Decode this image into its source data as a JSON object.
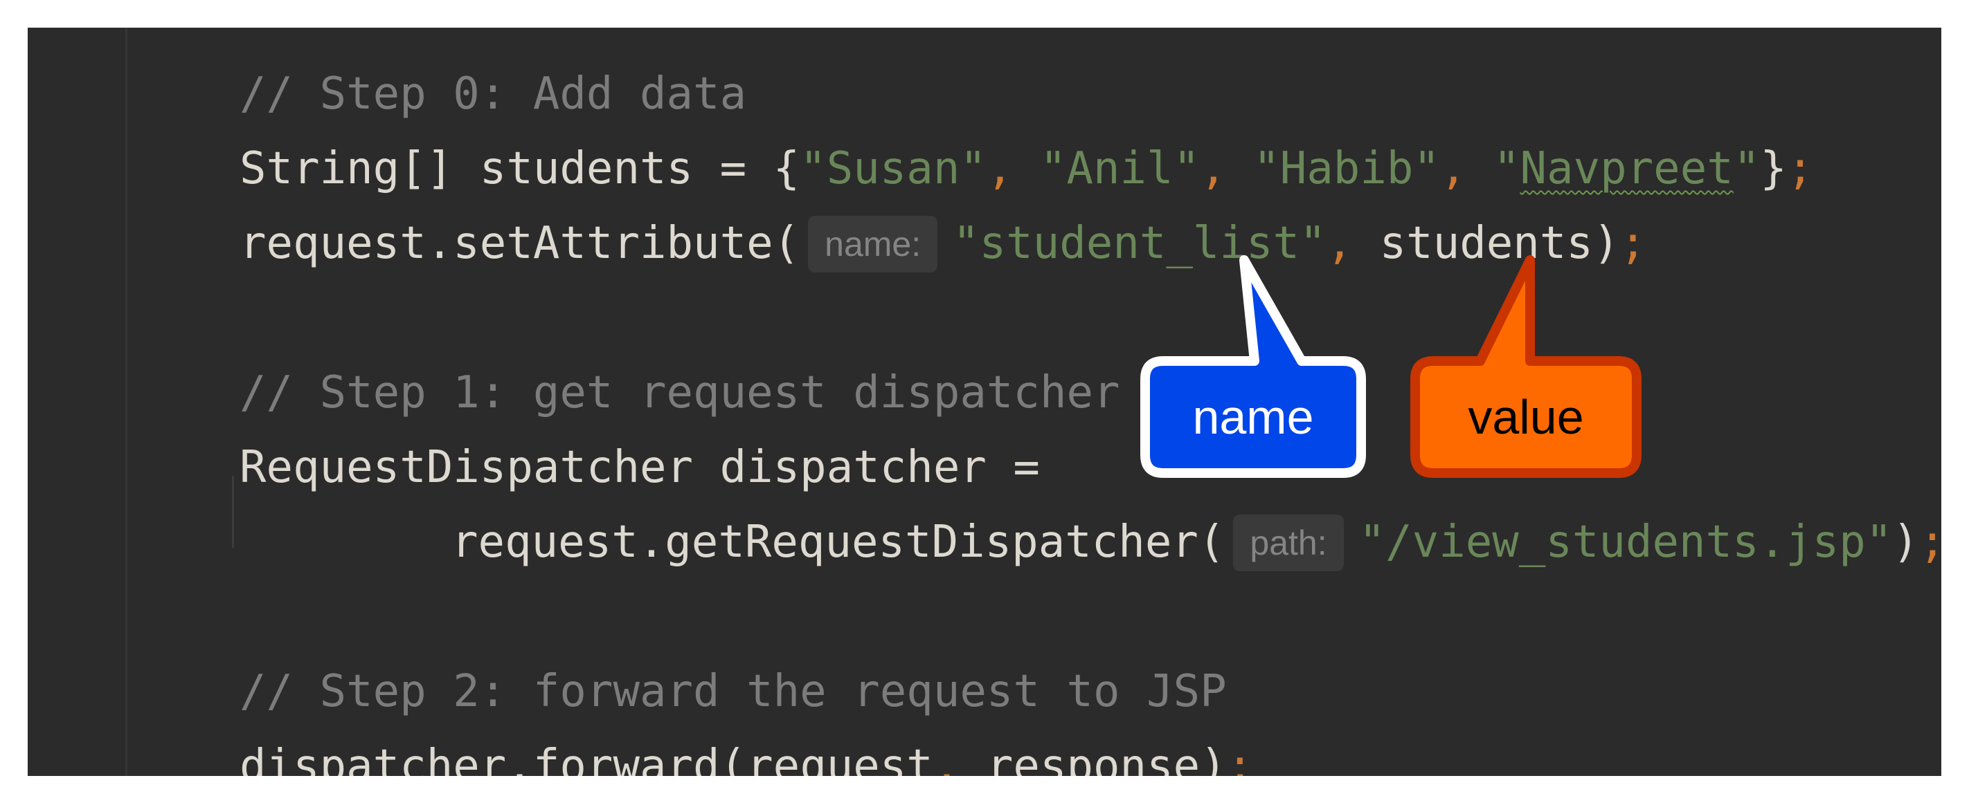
{
  "code": {
    "line1": {
      "comment": "// Step 0: Add data"
    },
    "line2": {
      "decl": "String[] students = {",
      "v1": "\"Susan\"",
      "c1": ", ",
      "v2": "\"Anil\"",
      "c2": ", ",
      "v3": "\"Habib\"",
      "c3": ", ",
      "v4_quote_open": "\"",
      "v4_word": "Navpreet",
      "v4_quote_close": "\"",
      "close": "}",
      "semi": ";"
    },
    "line3": {
      "call": "request.setAttribute(",
      "hint": "name:",
      "arg1": "\"student_list\"",
      "comma": ", ",
      "arg2": "students)",
      "semi": ";"
    },
    "line5": {
      "comment": "// Step 1: get request dispatcher"
    },
    "line6": {
      "text": "RequestDispatcher dispatcher ="
    },
    "line7": {
      "call": "request.getRequestDispatcher(",
      "hint": "path:",
      "arg": "\"/view_students.jsp\"",
      "close": ")",
      "semi": ";"
    },
    "line9": {
      "comment": "// Step 2: forward the request to JSP"
    },
    "line10": {
      "call": "dispatcher.forward(request",
      "comma": ", ",
      "rest": "response)",
      "semi": ";"
    }
  },
  "callouts": {
    "name": {
      "label": "name",
      "fill": "#0046e8",
      "stroke": "#ffffff",
      "text_color": "#ffffff"
    },
    "value": {
      "label": "value",
      "fill": "#ff6a00",
      "stroke": "#c93400",
      "text_color": "#000000"
    }
  },
  "colors": {
    "editor_bg": "#2b2b2b",
    "comment": "#7c7c7c",
    "string": "#6a8759",
    "punctuation": "#cc7832",
    "default_text": "#ddd9d0",
    "inlay_hint_bg": "#3a3a3a"
  }
}
